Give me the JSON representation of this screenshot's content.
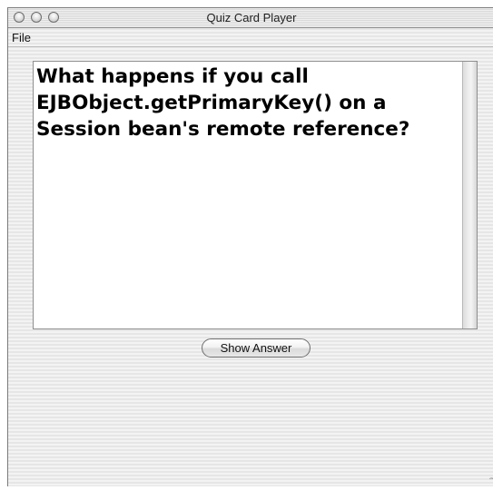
{
  "window": {
    "title": "Quiz Card Player"
  },
  "menu": {
    "file_label": "File"
  },
  "card": {
    "question": "What happens if you call\nEJBObject.getPrimaryKey() on a\nSession bean's remote reference?"
  },
  "buttons": {
    "show_answer_label": "Show Answer"
  },
  "icons": {
    "close": "close-button-icon",
    "minimize": "minimize-button-icon",
    "zoom": "zoom-button-icon",
    "resize": "resize-grip-icon"
  }
}
